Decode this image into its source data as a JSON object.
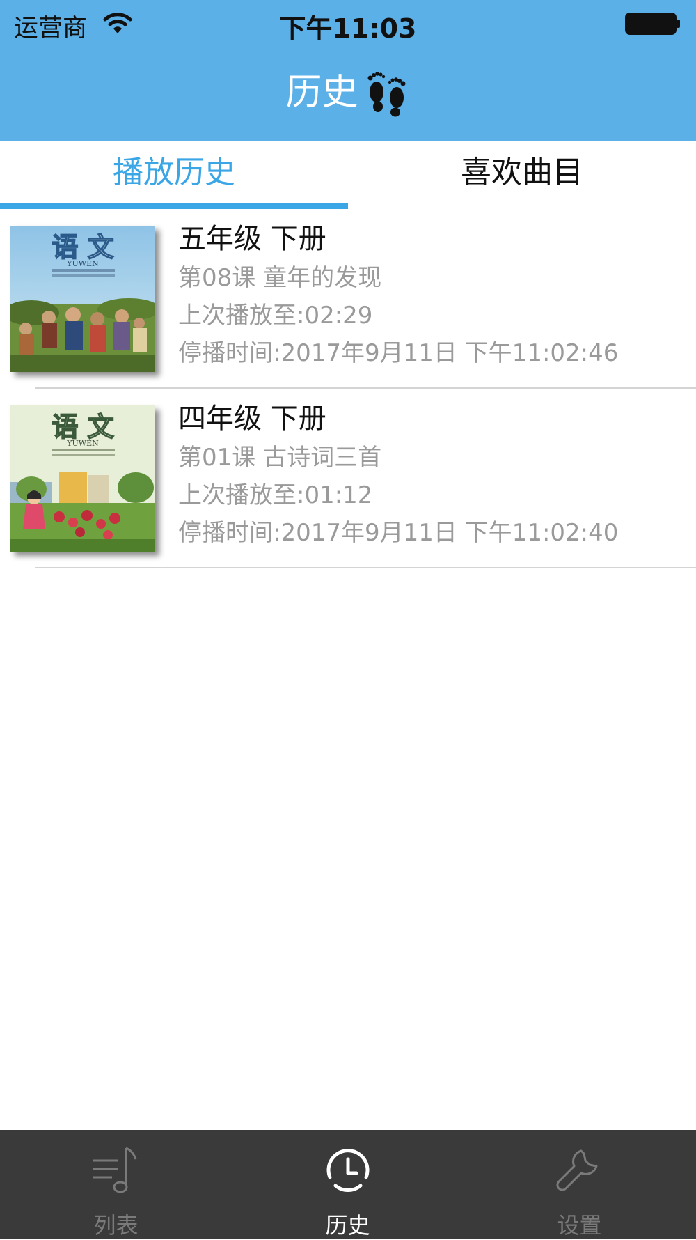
{
  "status_bar": {
    "carrier": "运营商",
    "time": "下午11:03"
  },
  "nav": {
    "title": "历史"
  },
  "tabs": [
    {
      "label": "播放历史",
      "active": true
    },
    {
      "label": "喜欢曲目",
      "active": false
    }
  ],
  "history_items": [
    {
      "title": "五年级 下册",
      "lesson": "第08课 童年的发现",
      "last_played": "上次播放至:02:29",
      "stop_time": "停播时间:2017年9月11日 下午11:02:46",
      "cover_title": "语 文",
      "cover_subtitle": "YUWEN"
    },
    {
      "title": "四年级 下册",
      "lesson": "第01课 古诗词三首",
      "last_played": "上次播放至:01:12",
      "stop_time": "停播时间:2017年9月11日 下午11:02:40",
      "cover_title": "语 文",
      "cover_subtitle": "YUWEN"
    }
  ],
  "tab_bar": {
    "items": [
      {
        "label": "列表",
        "icon": "music-list-icon",
        "active": false
      },
      {
        "label": "历史",
        "icon": "clock-icon",
        "active": true
      },
      {
        "label": "设置",
        "icon": "wrench-icon",
        "active": false
      }
    ]
  },
  "colors": {
    "header_bg": "#5bb0e8",
    "accent": "#3aa6e6",
    "tab_bar_bg": "#3a3a3a",
    "secondary_text": "#9a9a9a"
  }
}
